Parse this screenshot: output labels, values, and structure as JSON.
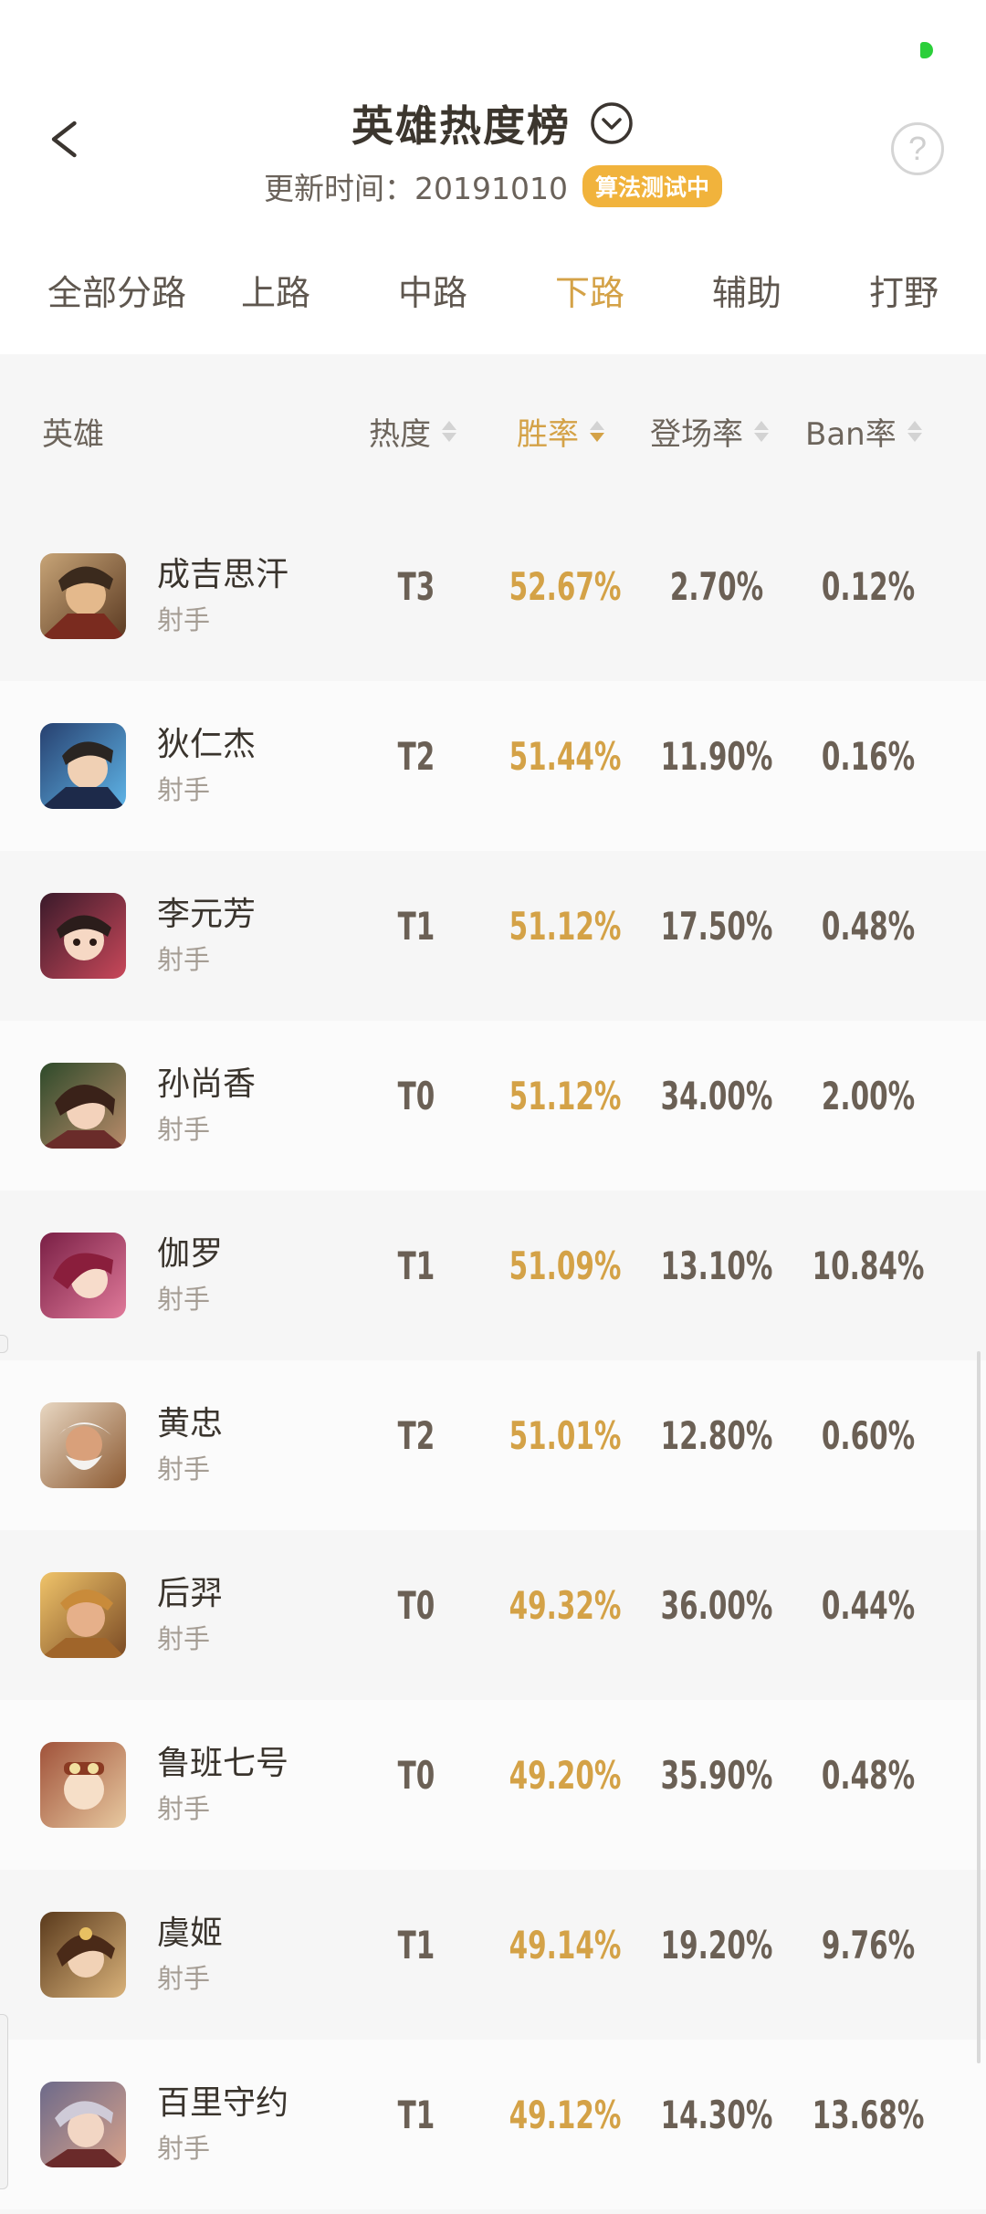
{
  "header": {
    "title": "英雄热度榜",
    "update_text": "更新时间：20191010",
    "algo_badge": "算法测试中",
    "help_label": "?"
  },
  "tabs": [
    {
      "label": "全部分路",
      "active": false
    },
    {
      "label": "上路",
      "active": false
    },
    {
      "label": "中路",
      "active": false
    },
    {
      "label": "下路",
      "active": true
    },
    {
      "label": "辅助",
      "active": false
    },
    {
      "label": "打野",
      "active": false
    }
  ],
  "table": {
    "columns": {
      "hero": "英雄",
      "heat": "热度",
      "winrate": "胜率",
      "appearance": "登场率",
      "ban": "Ban率"
    },
    "rows": [
      {
        "name": "成吉思汗",
        "role": "射手",
        "tier": "T3",
        "win": "52.67%",
        "appear": "2.70%",
        "ban": "0.12%"
      },
      {
        "name": "狄仁杰",
        "role": "射手",
        "tier": "T2",
        "win": "51.44%",
        "appear": "11.90%",
        "ban": "0.16%"
      },
      {
        "name": "李元芳",
        "role": "射手",
        "tier": "T1",
        "win": "51.12%",
        "appear": "17.50%",
        "ban": "0.48%"
      },
      {
        "name": "孙尚香",
        "role": "射手",
        "tier": "T0",
        "win": "51.12%",
        "appear": "34.00%",
        "ban": "2.00%"
      },
      {
        "name": "伽罗",
        "role": "射手",
        "tier": "T1",
        "win": "51.09%",
        "appear": "13.10%",
        "ban": "10.84%"
      },
      {
        "name": "黄忠",
        "role": "射手",
        "tier": "T2",
        "win": "51.01%",
        "appear": "12.80%",
        "ban": "0.60%"
      },
      {
        "name": "后羿",
        "role": "射手",
        "tier": "T0",
        "win": "49.32%",
        "appear": "36.00%",
        "ban": "0.44%"
      },
      {
        "name": "鲁班七号",
        "role": "射手",
        "tier": "T0",
        "win": "49.20%",
        "appear": "35.90%",
        "ban": "0.48%"
      },
      {
        "name": "虞姬",
        "role": "射手",
        "tier": "T1",
        "win": "49.14%",
        "appear": "19.20%",
        "ban": "9.76%"
      },
      {
        "name": "百里守约",
        "role": "射手",
        "tier": "T1",
        "win": "49.12%",
        "appear": "14.30%",
        "ban": "13.68%"
      }
    ]
  },
  "colors": {
    "accent": "#d4a247",
    "badge": "#f1b33c",
    "status_dot": "#2bcf3a"
  },
  "icons": {
    "back": "back-arrow-icon",
    "dropdown": "chevron-down-circle-icon",
    "help": "question-circle-icon",
    "sort": "sort-arrows-icon"
  }
}
